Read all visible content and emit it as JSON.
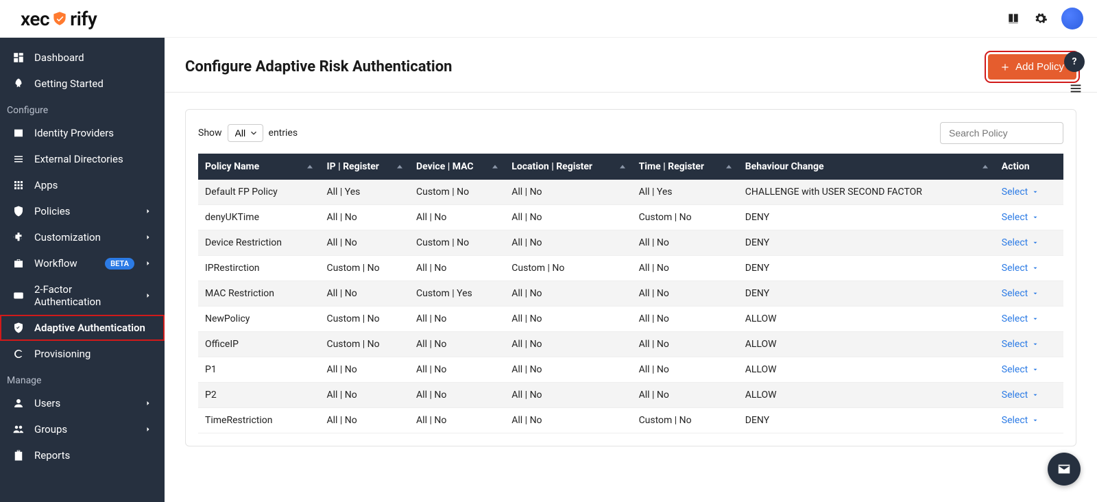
{
  "brand": {
    "name_pre": "xec",
    "name_post": "rify"
  },
  "sidebar": {
    "items": [
      {
        "label": "Dashboard",
        "icon": "dashboard"
      },
      {
        "label": "Getting Started",
        "icon": "rocket"
      }
    ],
    "section_configure": "Configure",
    "configure_items": [
      {
        "label": "Identity Providers",
        "icon": "idcard"
      },
      {
        "label": "External Directories",
        "icon": "list"
      },
      {
        "label": "Apps",
        "icon": "grid"
      },
      {
        "label": "Policies",
        "icon": "shield",
        "chevron": true
      },
      {
        "label": "Customization",
        "icon": "puzzle",
        "chevron": true
      },
      {
        "label": "Workflow",
        "icon": "briefcase",
        "badge": "BETA",
        "chevron": true
      },
      {
        "label": "2-Factor Authentication",
        "icon": "twofa",
        "chevron": true
      },
      {
        "label": "Adaptive Authentication",
        "icon": "shieldcheck",
        "active": true
      },
      {
        "label": "Provisioning",
        "icon": "sync"
      }
    ],
    "section_manage": "Manage",
    "manage_items": [
      {
        "label": "Users",
        "icon": "user",
        "chevron": true
      },
      {
        "label": "Groups",
        "icon": "group",
        "chevron": true
      },
      {
        "label": "Reports",
        "icon": "clipboard"
      }
    ]
  },
  "page": {
    "title": "Configure Adaptive Risk Authentication",
    "add_button": "Add Policy"
  },
  "table": {
    "show_label": "Show",
    "entries_label": "entries",
    "show_select_value": "All",
    "search_placeholder": "Search Policy",
    "columns": [
      "Policy Name",
      "IP | Register",
      "Device | MAC",
      "Location | Register",
      "Time | Register",
      "Behaviour Change",
      "Action"
    ],
    "action_label": "Select",
    "rows": [
      {
        "name": "Default FP Policy",
        "ip": "All | Yes",
        "device": "Custom | No",
        "location": "All | No",
        "time": "All | Yes",
        "behaviour": "CHALLENGE with USER SECOND FACTOR"
      },
      {
        "name": "denyUKTime",
        "ip": "All | No",
        "device": "All | No",
        "location": "All | No",
        "time": "Custom | No",
        "behaviour": "DENY"
      },
      {
        "name": "Device Restriction",
        "ip": "All | No",
        "device": "Custom | No",
        "location": "All | No",
        "time": "All | No",
        "behaviour": "DENY"
      },
      {
        "name": "IPRestirction",
        "ip": "Custom | No",
        "device": "All | No",
        "location": "Custom | No",
        "time": "All | No",
        "behaviour": "DENY"
      },
      {
        "name": "MAC Restriction",
        "ip": "All | No",
        "device": "Custom | Yes",
        "location": "All | No",
        "time": "All | No",
        "behaviour": "DENY"
      },
      {
        "name": "NewPolicy",
        "ip": "Custom | No",
        "device": "All | No",
        "location": "All | No",
        "time": "All | No",
        "behaviour": "ALLOW"
      },
      {
        "name": "OfficeIP",
        "ip": "Custom | No",
        "device": "All | No",
        "location": "All | No",
        "time": "All | No",
        "behaviour": "ALLOW"
      },
      {
        "name": "P1",
        "ip": "All | No",
        "device": "All | No",
        "location": "All | No",
        "time": "All | No",
        "behaviour": "ALLOW"
      },
      {
        "name": "P2",
        "ip": "All | No",
        "device": "All | No",
        "location": "All | No",
        "time": "All | No",
        "behaviour": "ALLOW"
      },
      {
        "name": "TimeRestriction",
        "ip": "All | No",
        "device": "All | No",
        "location": "All | No",
        "time": "Custom | No",
        "behaviour": "DENY"
      }
    ]
  }
}
